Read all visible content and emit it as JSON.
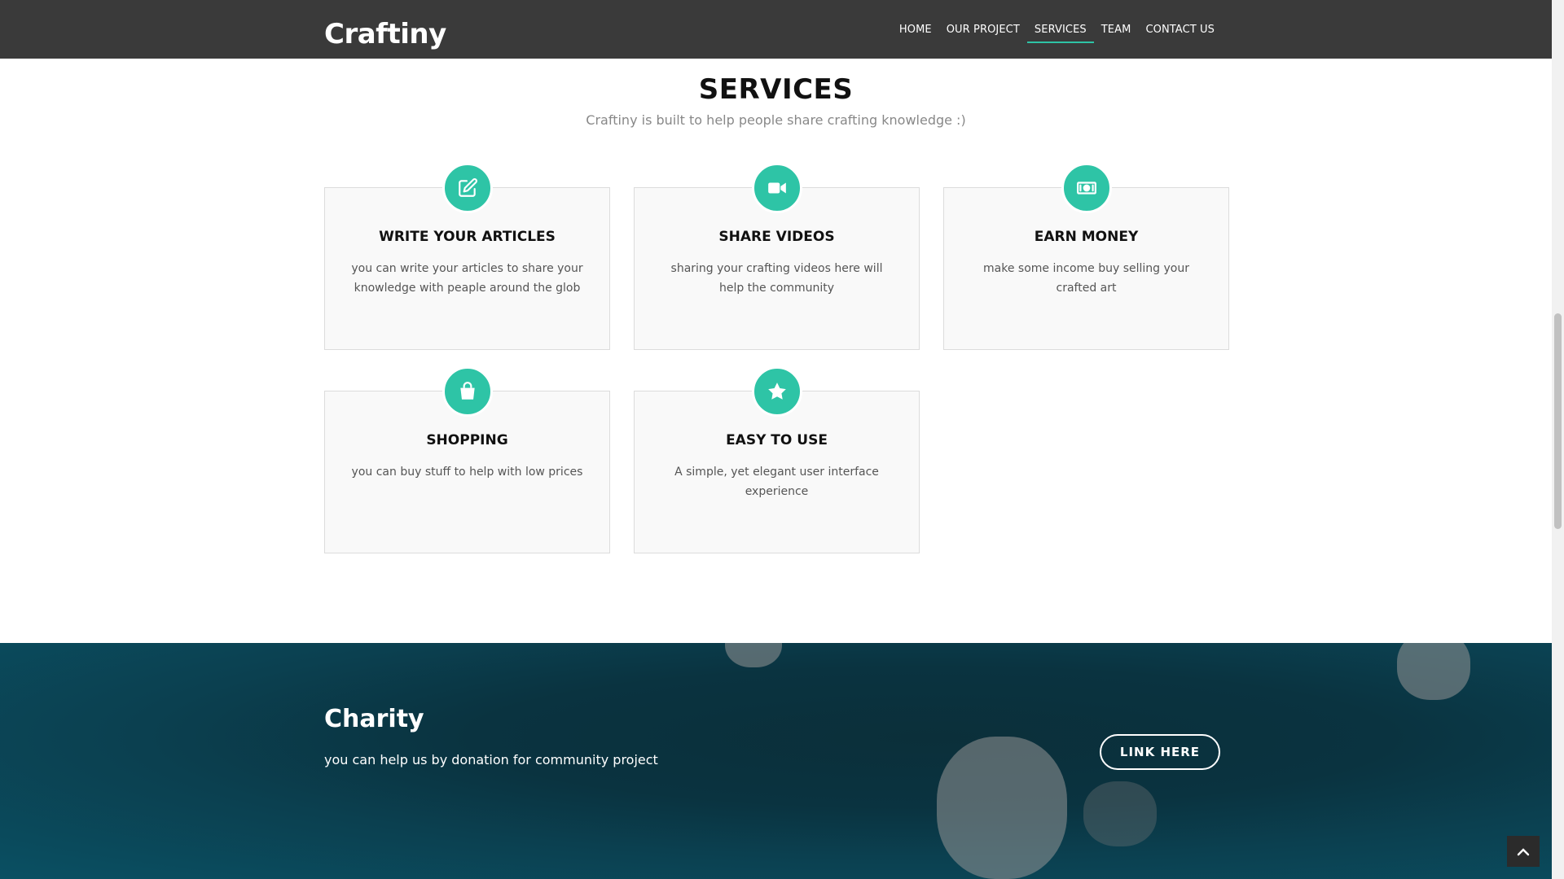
{
  "header": {
    "brand": "Craftiny",
    "nav": [
      {
        "label": "HOME",
        "active": false
      },
      {
        "label": "OUR PROJECT",
        "active": false
      },
      {
        "label": "SERVICES",
        "active": true
      },
      {
        "label": "TEAM",
        "active": false
      },
      {
        "label": "CONTACT US",
        "active": false
      }
    ]
  },
  "services": {
    "title": "SERVICES",
    "subtitle": "Craftiny is built to help people share crafting knowledge :)",
    "items": [
      {
        "icon": "edit-icon",
        "title": "WRITE YOUR ARTICLES",
        "text": "you can write your articles to share your knowledge with peaple around the glob"
      },
      {
        "icon": "video-camera-icon",
        "title": "SHARE VIDEOS",
        "text": "sharing your crafting videos here will help the community"
      },
      {
        "icon": "money-icon",
        "title": "EARN MONEY",
        "text": "make some income buy selling your crafted art"
      },
      {
        "icon": "shopping-bag-icon",
        "title": "SHOPPING",
        "text": "you can buy stuff to help with low prices"
      },
      {
        "icon": "star-icon",
        "title": "EASY TO USE",
        "text": "A simple, yet elegant user interface experience"
      }
    ]
  },
  "charity": {
    "title": "Charity",
    "text": "you can help us by donation for community project",
    "button": "LINK HERE"
  },
  "colors": {
    "accent": "#2ec4a6",
    "navbar": "#3a3a3a",
    "charity_bg": "#0b3a48"
  }
}
